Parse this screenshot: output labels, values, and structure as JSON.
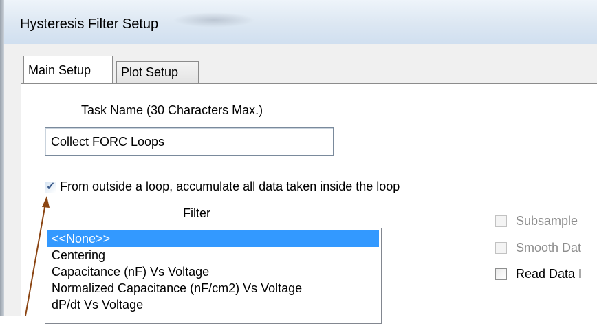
{
  "window": {
    "title": "Hysteresis Filter Setup"
  },
  "tabs": [
    {
      "label": "Main Setup",
      "active": true
    },
    {
      "label": "Plot Setup",
      "active": false
    }
  ],
  "task_name": {
    "label": "Task Name (30 Characters Max.)",
    "value": "Collect FORC Loops"
  },
  "accumulate": {
    "label": "From outside a loop, accumulate all data taken inside the loop",
    "checked": true
  },
  "filter": {
    "label": "Filter",
    "items": [
      "<<None>>",
      "Centering",
      "Capacitance (nF) Vs Voltage",
      "Normalized Capacitance (nF/cm2) Vs Voltage",
      "dP/dt Vs Voltage"
    ],
    "selected_index": 0
  },
  "options": {
    "subsample": {
      "label": "Subsample",
      "checked": false,
      "enabled": false
    },
    "smooth": {
      "label": "Smooth Dat",
      "checked": false,
      "enabled": false
    },
    "read_data": {
      "label": "Read Data I",
      "checked": false,
      "enabled": true
    }
  },
  "colors": {
    "selection": "#3399ff",
    "annotation_arrow": "#8b4513",
    "titlebar": "#dce7f2"
  }
}
